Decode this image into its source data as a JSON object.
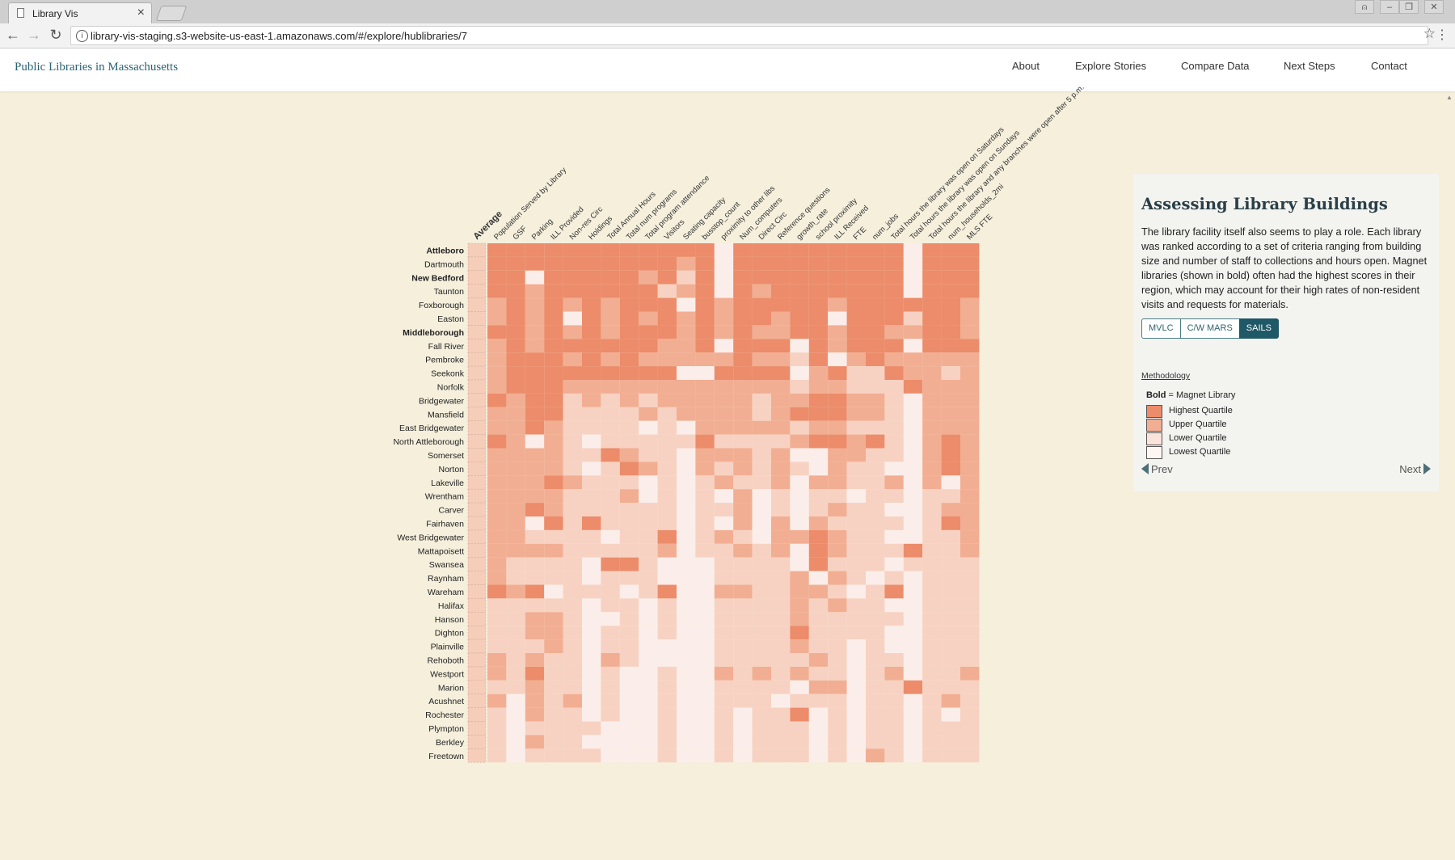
{
  "browser": {
    "tab_title": "Library Vis",
    "url": "library-vis-staging.s3-website-us-east-1.amazonaws.com/#/explore/hublibraries/7"
  },
  "site": {
    "title": "Public Libraries in Massachusetts",
    "nav": [
      "About",
      "Explore Stories",
      "Compare Data",
      "Next Steps",
      "Contact"
    ]
  },
  "heatmap": {
    "columns": [
      "Average",
      "Population Served by Library",
      "GSF",
      "Parking",
      "ILL Provided",
      "Non-res Circ",
      "Holdings",
      "Total Annual Hours",
      "Total num programs",
      "Total program attendance",
      "Visitors",
      "Seating capacity",
      "busstop_count",
      "proximity to other libs",
      "Num_computers",
      "Direct Circ",
      "Reference questions",
      "growth_rate",
      "school proximity",
      "ILL Received",
      "FTE",
      "num_jobs",
      "Total hours the library was open on Saturdays",
      "Total hours the library was open on Sundays",
      "Total hours the library and any branches were open after 5 p.m.",
      "num_households_2mi",
      "MLS FTE"
    ],
    "rows": [
      "Attleboro",
      "Dartmouth",
      "New Bedford",
      "Taunton",
      "Foxborough",
      "Easton",
      "Middleborough",
      "Fall River",
      "Pembroke",
      "Seekonk",
      "Norfolk",
      "Bridgewater",
      "Mansfield",
      "East Bridgewater",
      "North Attleborough",
      "Somerset",
      "Norton",
      "Lakeville",
      "Wrentham",
      "Carver",
      "Fairhaven",
      "West Bridgewater",
      "Mattapoisett",
      "Swansea",
      "Raynham",
      "Wareham",
      "Halifax",
      "Hanson",
      "Dighton",
      "Plainville",
      "Rehoboth",
      "Westport",
      "Marion",
      "Acushnet",
      "Rochester",
      "Plympton",
      "Berkley",
      "Freetown"
    ],
    "magnet_rows": [
      "Attleboro",
      "New Bedford",
      "Middleborough"
    ],
    "quartile_colors": [
      "#ec8c6a",
      "#f2ae93",
      "#f7d2c2",
      "#fbeeea"
    ],
    "grid": [
      [
        0,
        0,
        0,
        0,
        0,
        0,
        0,
        0,
        0,
        0,
        0,
        0,
        3,
        0,
        0,
        0,
        0,
        0,
        0,
        0,
        0,
        0,
        3,
        0,
        0,
        0
      ],
      [
        0,
        0,
        0,
        0,
        0,
        0,
        0,
        0,
        0,
        0,
        1,
        0,
        3,
        0,
        0,
        0,
        0,
        0,
        0,
        0,
        0,
        0,
        3,
        0,
        0,
        0
      ],
      [
        0,
        0,
        3,
        0,
        0,
        0,
        0,
        0,
        1,
        0,
        2,
        0,
        3,
        0,
        0,
        0,
        0,
        0,
        0,
        0,
        0,
        0,
        3,
        0,
        0,
        0
      ],
      [
        0,
        0,
        1,
        0,
        0,
        0,
        0,
        0,
        0,
        2,
        1,
        0,
        3,
        0,
        1,
        0,
        0,
        0,
        0,
        0,
        0,
        0,
        3,
        0,
        0,
        0
      ],
      [
        1,
        0,
        1,
        0,
        1,
        0,
        1,
        0,
        0,
        0,
        3,
        0,
        1,
        0,
        0,
        0,
        0,
        0,
        1,
        0,
        0,
        0,
        0,
        0,
        0,
        1
      ],
      [
        1,
        0,
        1,
        0,
        3,
        0,
        1,
        0,
        1,
        0,
        1,
        0,
        1,
        0,
        0,
        1,
        0,
        0,
        3,
        0,
        0,
        0,
        2,
        0,
        0,
        1
      ],
      [
        0,
        0,
        1,
        0,
        1,
        0,
        1,
        0,
        0,
        0,
        1,
        0,
        1,
        0,
        1,
        1,
        0,
        0,
        1,
        0,
        0,
        1,
        1,
        0,
        0,
        1
      ],
      [
        1,
        0,
        1,
        0,
        0,
        0,
        0,
        0,
        0,
        1,
        1,
        0,
        3,
        0,
        0,
        0,
        3,
        0,
        1,
        0,
        0,
        0,
        3,
        0,
        0,
        0
      ],
      [
        1,
        0,
        0,
        0,
        1,
        0,
        1,
        0,
        1,
        1,
        1,
        1,
        1,
        0,
        1,
        1,
        2,
        0,
        3,
        1,
        0,
        1,
        1,
        1,
        1,
        1
      ],
      [
        1,
        0,
        0,
        0,
        0,
        0,
        0,
        0,
        0,
        0,
        3,
        3,
        0,
        0,
        0,
        0,
        3,
        1,
        0,
        2,
        2,
        0,
        1,
        1,
        2,
        1
      ],
      [
        1,
        0,
        0,
        0,
        1,
        1,
        1,
        1,
        1,
        1,
        1,
        1,
        1,
        1,
        1,
        1,
        2,
        1,
        1,
        2,
        2,
        2,
        0,
        1,
        1,
        1
      ],
      [
        0,
        1,
        0,
        0,
        2,
        1,
        2,
        1,
        2,
        1,
        1,
        1,
        1,
        1,
        2,
        1,
        1,
        0,
        0,
        1,
        1,
        2,
        3,
        1,
        1,
        1
      ],
      [
        1,
        1,
        0,
        0,
        2,
        2,
        2,
        2,
        1,
        2,
        1,
        1,
        1,
        1,
        2,
        1,
        0,
        0,
        0,
        1,
        1,
        2,
        3,
        1,
        1,
        1
      ],
      [
        1,
        1,
        0,
        1,
        2,
        2,
        2,
        2,
        3,
        2,
        3,
        1,
        1,
        1,
        1,
        1,
        2,
        1,
        1,
        2,
        2,
        2,
        3,
        1,
        1,
        1
      ],
      [
        0,
        1,
        3,
        1,
        2,
        3,
        2,
        2,
        2,
        2,
        2,
        0,
        2,
        2,
        2,
        2,
        1,
        0,
        0,
        1,
        0,
        2,
        3,
        1,
        0,
        1
      ],
      [
        1,
        1,
        1,
        1,
        2,
        2,
        0,
        1,
        2,
        2,
        3,
        1,
        1,
        1,
        2,
        1,
        3,
        3,
        1,
        1,
        2,
        2,
        3,
        1,
        0,
        1
      ],
      [
        1,
        1,
        1,
        1,
        2,
        3,
        2,
        0,
        1,
        2,
        3,
        1,
        2,
        1,
        2,
        1,
        2,
        3,
        1,
        2,
        2,
        3,
        3,
        1,
        0,
        1
      ],
      [
        1,
        1,
        1,
        0,
        1,
        2,
        2,
        2,
        3,
        2,
        3,
        2,
        1,
        2,
        2,
        1,
        3,
        1,
        1,
        2,
        2,
        1,
        3,
        1,
        3,
        1
      ],
      [
        1,
        1,
        1,
        1,
        2,
        2,
        2,
        1,
        3,
        2,
        3,
        2,
        3,
        1,
        3,
        2,
        3,
        2,
        2,
        3,
        2,
        2,
        3,
        2,
        2,
        1
      ],
      [
        1,
        1,
        0,
        1,
        2,
        2,
        2,
        2,
        2,
        2,
        3,
        2,
        2,
        1,
        3,
        2,
        3,
        2,
        1,
        2,
        2,
        3,
        3,
        2,
        1,
        1
      ],
      [
        1,
        1,
        3,
        0,
        2,
        0,
        2,
        2,
        2,
        2,
        3,
        2,
        3,
        1,
        3,
        1,
        3,
        1,
        2,
        2,
        2,
        2,
        3,
        2,
        0,
        1
      ],
      [
        1,
        1,
        2,
        2,
        2,
        2,
        3,
        2,
        2,
        0,
        3,
        2,
        1,
        2,
        3,
        1,
        1,
        0,
        1,
        2,
        2,
        3,
        3,
        2,
        2,
        1
      ],
      [
        1,
        1,
        1,
        1,
        2,
        2,
        2,
        2,
        2,
        1,
        3,
        2,
        2,
        1,
        2,
        1,
        3,
        0,
        1,
        2,
        2,
        2,
        0,
        2,
        2,
        1
      ],
      [
        1,
        2,
        2,
        2,
        2,
        3,
        0,
        0,
        2,
        3,
        3,
        3,
        2,
        2,
        2,
        2,
        3,
        0,
        2,
        2,
        2,
        3,
        2,
        2,
        2,
        2
      ],
      [
        1,
        2,
        2,
        2,
        2,
        3,
        2,
        2,
        2,
        3,
        3,
        3,
        2,
        2,
        2,
        2,
        1,
        3,
        1,
        2,
        3,
        2,
        3,
        2,
        2,
        2
      ],
      [
        0,
        1,
        0,
        3,
        2,
        2,
        2,
        3,
        2,
        0,
        3,
        3,
        1,
        1,
        2,
        2,
        1,
        1,
        2,
        3,
        2,
        0,
        3,
        2,
        2,
        2
      ],
      [
        2,
        2,
        2,
        2,
        2,
        3,
        2,
        2,
        3,
        2,
        3,
        3,
        2,
        2,
        2,
        2,
        1,
        2,
        1,
        2,
        2,
        3,
        3,
        2,
        2,
        2
      ],
      [
        2,
        2,
        1,
        1,
        2,
        3,
        3,
        2,
        3,
        2,
        3,
        3,
        2,
        2,
        2,
        2,
        1,
        2,
        2,
        2,
        2,
        2,
        3,
        2,
        2,
        2
      ],
      [
        2,
        2,
        1,
        1,
        2,
        3,
        2,
        2,
        3,
        2,
        3,
        3,
        2,
        2,
        2,
        2,
        0,
        2,
        2,
        2,
        2,
        3,
        3,
        2,
        2,
        2
      ],
      [
        2,
        2,
        2,
        1,
        2,
        3,
        2,
        2,
        3,
        3,
        3,
        3,
        2,
        2,
        2,
        2,
        1,
        2,
        2,
        3,
        2,
        3,
        3,
        2,
        2,
        2
      ],
      [
        1,
        2,
        1,
        2,
        2,
        3,
        1,
        2,
        3,
        3,
        3,
        3,
        2,
        2,
        2,
        2,
        2,
        1,
        2,
        3,
        2,
        2,
        3,
        2,
        2,
        2
      ],
      [
        1,
        2,
        0,
        2,
        2,
        3,
        2,
        3,
        3,
        2,
        3,
        3,
        1,
        2,
        1,
        2,
        1,
        2,
        2,
        3,
        2,
        1,
        3,
        2,
        2,
        1
      ],
      [
        2,
        2,
        1,
        2,
        2,
        3,
        2,
        3,
        3,
        2,
        3,
        3,
        2,
        2,
        2,
        2,
        3,
        1,
        1,
        3,
        2,
        2,
        0,
        2,
        2,
        2
      ],
      [
        1,
        3,
        1,
        2,
        1,
        3,
        2,
        3,
        3,
        2,
        3,
        3,
        2,
        2,
        2,
        3,
        2,
        2,
        2,
        3,
        2,
        2,
        3,
        2,
        1,
        2
      ],
      [
        2,
        3,
        1,
        2,
        2,
        3,
        2,
        3,
        3,
        2,
        3,
        3,
        2,
        3,
        2,
        2,
        0,
        3,
        2,
        3,
        2,
        2,
        3,
        2,
        3,
        2
      ],
      [
        2,
        3,
        2,
        2,
        2,
        2,
        3,
        3,
        3,
        2,
        3,
        3,
        2,
        3,
        2,
        2,
        2,
        3,
        2,
        3,
        2,
        2,
        3,
        2,
        2,
        2
      ],
      [
        2,
        3,
        1,
        2,
        2,
        3,
        3,
        3,
        3,
        2,
        3,
        3,
        2,
        3,
        2,
        2,
        2,
        3,
        2,
        3,
        2,
        2,
        3,
        2,
        2,
        2
      ],
      [
        2,
        3,
        2,
        2,
        2,
        2,
        3,
        3,
        3,
        2,
        3,
        3,
        2,
        3,
        2,
        2,
        2,
        3,
        2,
        3,
        1,
        2,
        3,
        2,
        2,
        2
      ]
    ]
  },
  "panel": {
    "title": "Assessing Library Buildings",
    "text": "The library facility itself also seems to play a role. Each library was ranked according to a set of criteria ranging from building size and number of staff to collections and hours open. Magnet libraries (shown in bold) often had the highest scores in their region, which may account for their high rates of non-resident visits and requests for materials.",
    "region_tabs": [
      "MVLC",
      "C/W MARS",
      "SAILS"
    ],
    "active_region": "SAILS",
    "methodology": "Methodology",
    "legend": {
      "bold_word": "Bold",
      "bold_rest": " = Magnet Library",
      "items": [
        "Highest Quartile",
        "Upper Quartile",
        "Lower Quartile",
        "Lowest Quartile"
      ]
    },
    "prev": "Prev",
    "next": "Next"
  }
}
